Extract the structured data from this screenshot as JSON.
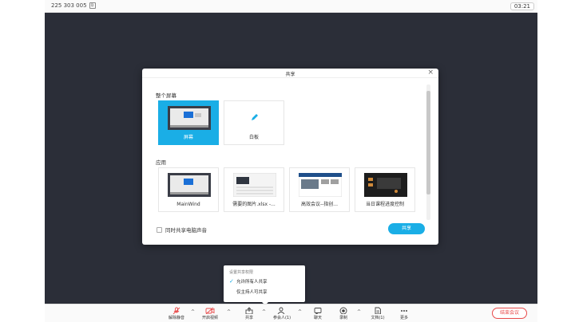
{
  "header": {
    "meeting_id": "225 303 005",
    "timer": "03:21"
  },
  "dialog": {
    "title": "共享",
    "section_screens": "整个屏幕",
    "section_apps": "应用",
    "screens": [
      {
        "label": "屏幕",
        "selected": true,
        "icon": "screen-thumbnail"
      },
      {
        "label": "白板",
        "selected": false,
        "icon": "pen-icon"
      }
    ],
    "apps": [
      {
        "label": "MainWind"
      },
      {
        "label": "需要的图片.xlsx -..."
      },
      {
        "label": "高效会议--指创..."
      },
      {
        "label": "当日课程进度控制"
      }
    ],
    "share_audio_label": "同时共享电脑声音",
    "share_button": "共享"
  },
  "popup": {
    "title": "设置共享权限",
    "options": [
      {
        "label": "允许所有人共享",
        "checked": true
      },
      {
        "label": "仅主持人可共享",
        "checked": false
      }
    ]
  },
  "toolbar": {
    "items": [
      {
        "label": "解除静音",
        "icon": "mic-muted-icon"
      },
      {
        "label": "开启视频",
        "icon": "camera-off-icon"
      },
      {
        "label": "共享",
        "icon": "share-icon"
      },
      {
        "label": "参会人(1)",
        "icon": "participants-icon"
      },
      {
        "label": "聊天",
        "icon": "chat-icon"
      },
      {
        "label": "录制",
        "icon": "record-icon"
      },
      {
        "label": "文档(1)",
        "icon": "document-icon"
      },
      {
        "label": "更多",
        "icon": "more-icon"
      }
    ],
    "end_meeting": "结束会议"
  },
  "colors": {
    "accent": "#1aaee6",
    "danger": "#e84a4a",
    "stage": "#2b2e38"
  }
}
